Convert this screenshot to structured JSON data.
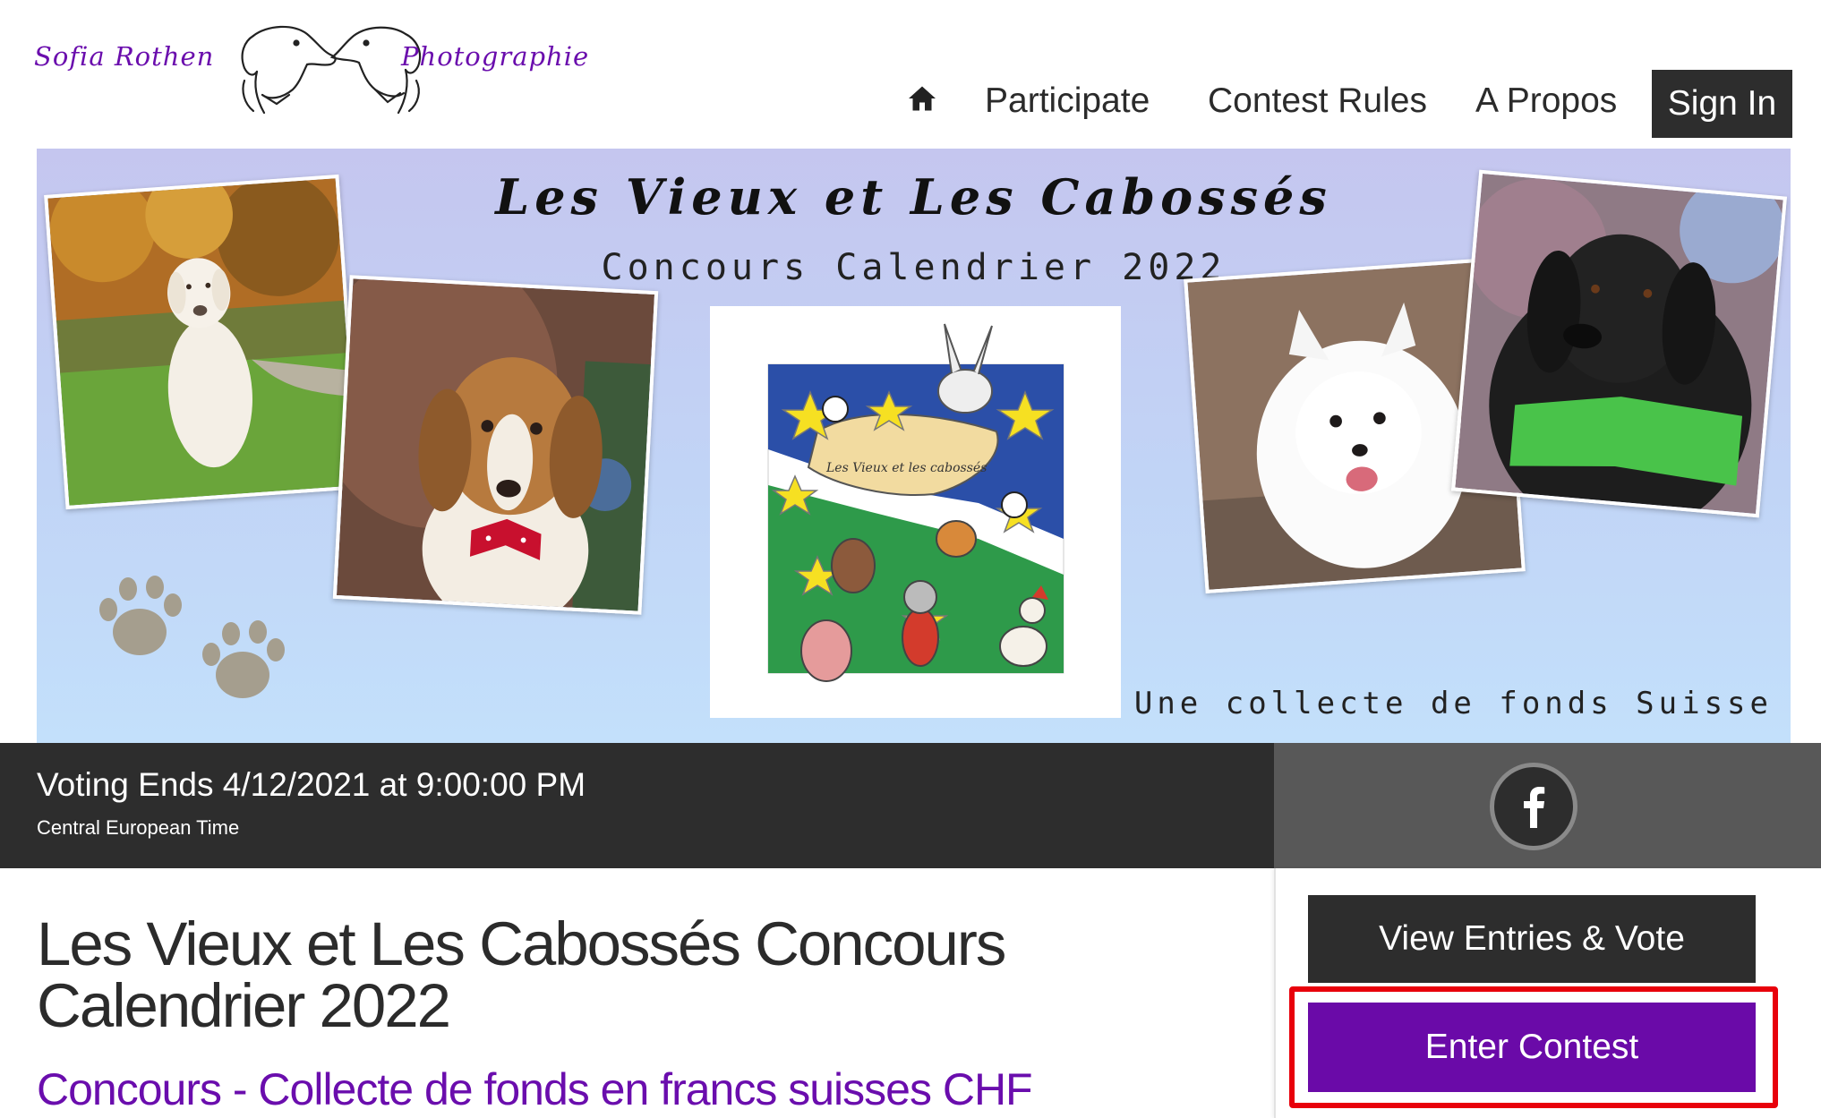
{
  "header": {
    "logo_left": "Sofia Rothen",
    "logo_right": "Photographie",
    "nav": {
      "home_icon": "home-icon",
      "participate": "Participate",
      "contest_rules": "Contest Rules",
      "a_propos": "A Propos",
      "sign_in": "Sign In"
    }
  },
  "banner": {
    "title": "Les Vieux et Les Cabossés",
    "subtitle": "Concours Calendrier 2022",
    "footer": "Une collecte de fonds Suisse",
    "poster_caption": "Les Vieux et les cabossés"
  },
  "voting": {
    "title": "Voting Ends 4/12/2021 at 9:00:00 PM",
    "timezone": "Central European Time",
    "social_icon": "facebook-icon"
  },
  "main": {
    "title": "Les Vieux et Les Cabossés Concours Calendrier 2022",
    "subtitle": "Concours - Collecte de fonds en francs suisses CHF"
  },
  "actions": {
    "view_entries": "View Entries & Vote",
    "enter_contest": "Enter Contest"
  },
  "colors": {
    "brand_purple": "#6a0dad",
    "dark_button": "#2d2d2d",
    "highlight_red": "#e8000b"
  }
}
